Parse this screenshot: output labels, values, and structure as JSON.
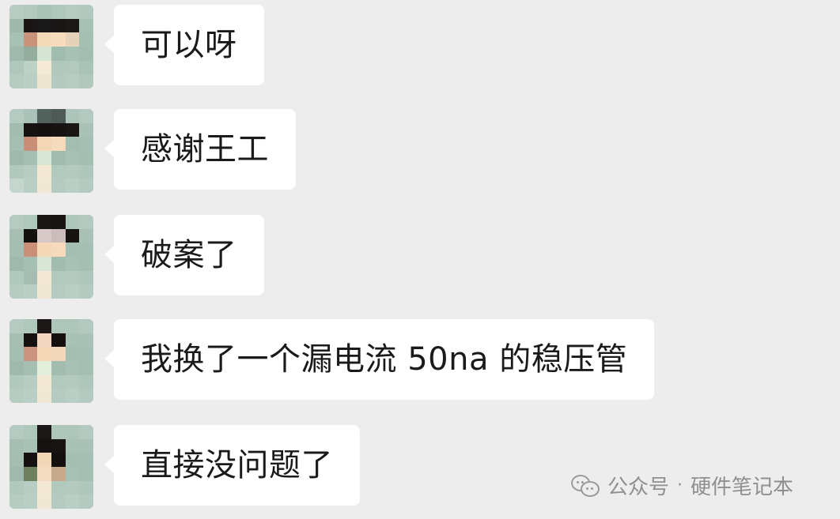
{
  "messages": [
    {
      "text": "可以呀"
    },
    {
      "text": "感谢王工"
    },
    {
      "text": "破案了"
    },
    {
      "text": "我换了一个漏电流 50na 的稳压管"
    },
    {
      "text": "直接没问题了"
    }
  ],
  "watermark": {
    "icon": "wechat-icon",
    "prefix": "公众号",
    "separator": "·",
    "account": "硬件笔记本"
  },
  "colors": {
    "background": "#ededed",
    "bubble": "#ffffff",
    "text": "#1a1a1a",
    "watermark_text": "#8f8f8f"
  }
}
